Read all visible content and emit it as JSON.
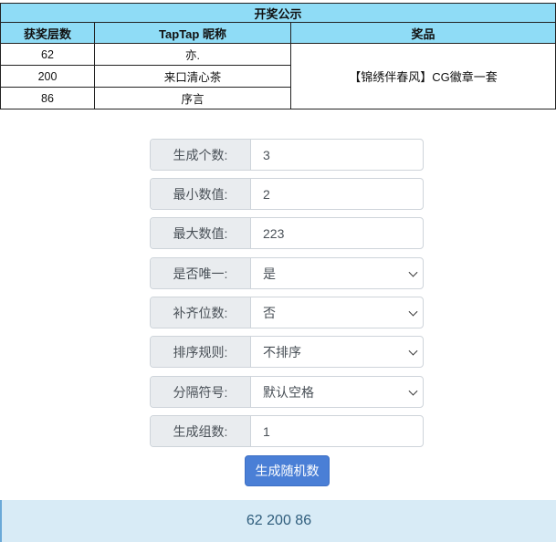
{
  "announcement": {
    "title": "开奖公示",
    "columns": [
      "获奖层数",
      "TapTap 昵称",
      "奖品"
    ],
    "rows": [
      {
        "floor": "62",
        "nickname": "亦."
      },
      {
        "floor": "200",
        "nickname": "来口清心茶"
      },
      {
        "floor": "86",
        "nickname": "序言"
      }
    ],
    "prize": "【锦绣伴春风】CG徽章一套"
  },
  "generator": {
    "fields": [
      {
        "label": "生成个数:",
        "value": "3",
        "type": "input"
      },
      {
        "label": "最小数值:",
        "value": "2",
        "type": "input"
      },
      {
        "label": "最大数值:",
        "value": "223",
        "type": "input"
      },
      {
        "label": "是否唯一:",
        "value": "是",
        "type": "select"
      },
      {
        "label": "补齐位数:",
        "value": "否",
        "type": "select"
      },
      {
        "label": "排序规则:",
        "value": "不排序",
        "type": "select"
      },
      {
        "label": "分隔符号:",
        "value": "默认空格",
        "type": "select"
      },
      {
        "label": "生成组数:",
        "value": "1",
        "type": "input"
      }
    ],
    "button_label": "生成随机数",
    "result": "62 200 86"
  },
  "colors": {
    "table_header_bg": "#8fdcf6",
    "button_bg": "#4a7fd6",
    "result_bg": "#d8ebf6"
  }
}
